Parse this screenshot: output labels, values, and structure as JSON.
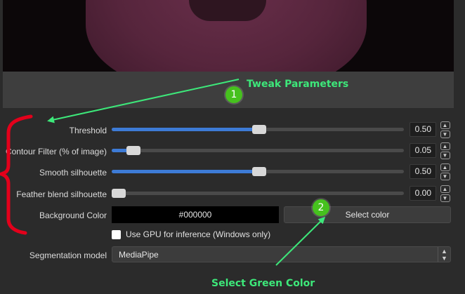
{
  "annotations": {
    "tweak_title": "Tweak Parameters",
    "tweak_number": "1",
    "select_title": "Select Green Color",
    "select_number": "2",
    "accent_green": "#3de87a",
    "badge_green": "#46c11e",
    "bracket_red": "#e3001b"
  },
  "sliders": [
    {
      "label": "Threshold",
      "value_text": "0.50",
      "fraction": 0.505
    },
    {
      "label": "Contour Filter (% of image)",
      "value_text": "0.05",
      "fraction": 0.075
    },
    {
      "label": "Smooth silhouette",
      "value_text": "0.50",
      "fraction": 0.505
    },
    {
      "label": "Feather blend silhouette",
      "value_text": "0.00",
      "fraction": 0.02
    }
  ],
  "background": {
    "label": "Background Color",
    "color_value": "#000000",
    "button_label": "Select color"
  },
  "gpu": {
    "label": "Use GPU for inference (Windows only)",
    "checked": false
  },
  "segmentation": {
    "label": "Segmentation model",
    "value": "MediaPipe"
  },
  "colors": {
    "slider_fill": "#3d7bd6",
    "panel_bg": "#2b2b2b"
  }
}
